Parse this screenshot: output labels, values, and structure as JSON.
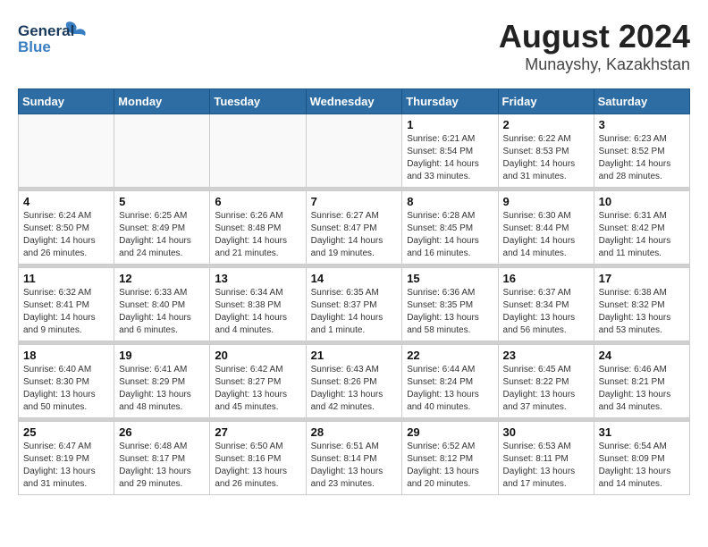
{
  "header": {
    "logo_line1": "General",
    "logo_line2": "Blue",
    "month": "August 2024",
    "location": "Munayshy, Kazakhstan"
  },
  "weekdays": [
    "Sunday",
    "Monday",
    "Tuesday",
    "Wednesday",
    "Thursday",
    "Friday",
    "Saturday"
  ],
  "weeks": [
    [
      {
        "day": "",
        "info": ""
      },
      {
        "day": "",
        "info": ""
      },
      {
        "day": "",
        "info": ""
      },
      {
        "day": "",
        "info": ""
      },
      {
        "day": "1",
        "info": "Sunrise: 6:21 AM\nSunset: 8:54 PM\nDaylight: 14 hours\nand 33 minutes."
      },
      {
        "day": "2",
        "info": "Sunrise: 6:22 AM\nSunset: 8:53 PM\nDaylight: 14 hours\nand 31 minutes."
      },
      {
        "day": "3",
        "info": "Sunrise: 6:23 AM\nSunset: 8:52 PM\nDaylight: 14 hours\nand 28 minutes."
      }
    ],
    [
      {
        "day": "4",
        "info": "Sunrise: 6:24 AM\nSunset: 8:50 PM\nDaylight: 14 hours\nand 26 minutes."
      },
      {
        "day": "5",
        "info": "Sunrise: 6:25 AM\nSunset: 8:49 PM\nDaylight: 14 hours\nand 24 minutes."
      },
      {
        "day": "6",
        "info": "Sunrise: 6:26 AM\nSunset: 8:48 PM\nDaylight: 14 hours\nand 21 minutes."
      },
      {
        "day": "7",
        "info": "Sunrise: 6:27 AM\nSunset: 8:47 PM\nDaylight: 14 hours\nand 19 minutes."
      },
      {
        "day": "8",
        "info": "Sunrise: 6:28 AM\nSunset: 8:45 PM\nDaylight: 14 hours\nand 16 minutes."
      },
      {
        "day": "9",
        "info": "Sunrise: 6:30 AM\nSunset: 8:44 PM\nDaylight: 14 hours\nand 14 minutes."
      },
      {
        "day": "10",
        "info": "Sunrise: 6:31 AM\nSunset: 8:42 PM\nDaylight: 14 hours\nand 11 minutes."
      }
    ],
    [
      {
        "day": "11",
        "info": "Sunrise: 6:32 AM\nSunset: 8:41 PM\nDaylight: 14 hours\nand 9 minutes."
      },
      {
        "day": "12",
        "info": "Sunrise: 6:33 AM\nSunset: 8:40 PM\nDaylight: 14 hours\nand 6 minutes."
      },
      {
        "day": "13",
        "info": "Sunrise: 6:34 AM\nSunset: 8:38 PM\nDaylight: 14 hours\nand 4 minutes."
      },
      {
        "day": "14",
        "info": "Sunrise: 6:35 AM\nSunset: 8:37 PM\nDaylight: 14 hours\nand 1 minute."
      },
      {
        "day": "15",
        "info": "Sunrise: 6:36 AM\nSunset: 8:35 PM\nDaylight: 13 hours\nand 58 minutes."
      },
      {
        "day": "16",
        "info": "Sunrise: 6:37 AM\nSunset: 8:34 PM\nDaylight: 13 hours\nand 56 minutes."
      },
      {
        "day": "17",
        "info": "Sunrise: 6:38 AM\nSunset: 8:32 PM\nDaylight: 13 hours\nand 53 minutes."
      }
    ],
    [
      {
        "day": "18",
        "info": "Sunrise: 6:40 AM\nSunset: 8:30 PM\nDaylight: 13 hours\nand 50 minutes."
      },
      {
        "day": "19",
        "info": "Sunrise: 6:41 AM\nSunset: 8:29 PM\nDaylight: 13 hours\nand 48 minutes."
      },
      {
        "day": "20",
        "info": "Sunrise: 6:42 AM\nSunset: 8:27 PM\nDaylight: 13 hours\nand 45 minutes."
      },
      {
        "day": "21",
        "info": "Sunrise: 6:43 AM\nSunset: 8:26 PM\nDaylight: 13 hours\nand 42 minutes."
      },
      {
        "day": "22",
        "info": "Sunrise: 6:44 AM\nSunset: 8:24 PM\nDaylight: 13 hours\nand 40 minutes."
      },
      {
        "day": "23",
        "info": "Sunrise: 6:45 AM\nSunset: 8:22 PM\nDaylight: 13 hours\nand 37 minutes."
      },
      {
        "day": "24",
        "info": "Sunrise: 6:46 AM\nSunset: 8:21 PM\nDaylight: 13 hours\nand 34 minutes."
      }
    ],
    [
      {
        "day": "25",
        "info": "Sunrise: 6:47 AM\nSunset: 8:19 PM\nDaylight: 13 hours\nand 31 minutes."
      },
      {
        "day": "26",
        "info": "Sunrise: 6:48 AM\nSunset: 8:17 PM\nDaylight: 13 hours\nand 29 minutes."
      },
      {
        "day": "27",
        "info": "Sunrise: 6:50 AM\nSunset: 8:16 PM\nDaylight: 13 hours\nand 26 minutes."
      },
      {
        "day": "28",
        "info": "Sunrise: 6:51 AM\nSunset: 8:14 PM\nDaylight: 13 hours\nand 23 minutes."
      },
      {
        "day": "29",
        "info": "Sunrise: 6:52 AM\nSunset: 8:12 PM\nDaylight: 13 hours\nand 20 minutes."
      },
      {
        "day": "30",
        "info": "Sunrise: 6:53 AM\nSunset: 8:11 PM\nDaylight: 13 hours\nand 17 minutes."
      },
      {
        "day": "31",
        "info": "Sunrise: 6:54 AM\nSunset: 8:09 PM\nDaylight: 13 hours\nand 14 minutes."
      }
    ]
  ]
}
